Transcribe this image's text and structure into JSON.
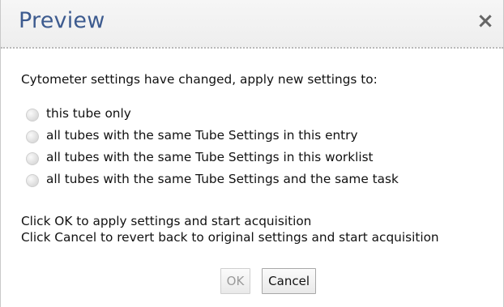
{
  "dialog": {
    "title": "Preview",
    "close_symbol": "×",
    "prompt": "Cytometer settings have changed, apply new settings to:",
    "options": [
      {
        "label": "this tube only",
        "selected": false
      },
      {
        "label": "all tubes with the same Tube Settings in this entry",
        "selected": false
      },
      {
        "label": "all tubes with the same Tube Settings in this worklist",
        "selected": false
      },
      {
        "label": "all tubes with the same Tube Settings and the same task",
        "selected": false
      }
    ],
    "info_line_1": "Click OK to apply settings and start acquisition",
    "info_line_2": "Click Cancel to revert back to original settings and start acquisition",
    "ok_label": "OK",
    "cancel_label": "Cancel"
  },
  "colors": {
    "title": "#3d5b8f",
    "disabled_text": "#9a9a9a"
  }
}
